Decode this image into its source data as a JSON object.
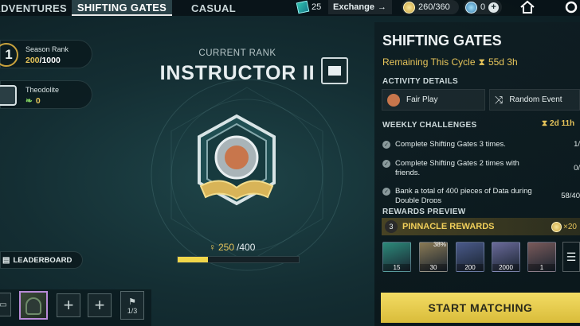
{
  "tabs": [
    {
      "label": "ADVENTURES"
    },
    {
      "label": "SHIFTING GATES"
    },
    {
      "label": "CASUAL"
    }
  ],
  "resources": {
    "cards": "25",
    "exchange": "Exchange",
    "coins": "260/360",
    "gems": "0"
  },
  "left": {
    "season_rank_label": "Season Rank",
    "season_rank_num": "1",
    "season_rank_value": "200",
    "season_rank_max": "/1000",
    "theodolite_label": "Theodolite",
    "theodolite_value": "0",
    "leaderboard": "LEADERBOARD",
    "party_count": "1/3"
  },
  "center": {
    "current_rank_label": "CURRENT RANK",
    "rank_title": "INSTRUCTOR II",
    "progress_current": "250",
    "progress_max": "/400",
    "progress_fraction": 0.25
  },
  "panel": {
    "title": "SHIFTING GATES",
    "remaining_label": "Remaining This Cycle",
    "remaining_time": "55d 3h",
    "activity_details": "ACTIVITY DETAILS",
    "fair_play": "Fair Play",
    "random_event": "Random Event",
    "weekly_challenges": "WEEKLY CHALLENGES",
    "weekly_time": "2d 11h",
    "challenges": [
      {
        "text": "Complete Shifting Gates 3 times.",
        "progress": "1/"
      },
      {
        "text": "Complete Shifting Gates 2 times with friends.",
        "progress": "0/"
      },
      {
        "text": "Bank a total of 400 pieces of Data during Double Drops",
        "progress": "58/40"
      }
    ],
    "rewards_preview": "REWARDS PREVIEW",
    "pinnacle_rank": "3",
    "pinnacle_label": "PINNACLE REWARDS",
    "pinnacle_mult": "×20",
    "rewards": [
      {
        "count": "15",
        "color": "#2c8a7a"
      },
      {
        "count": "30",
        "color": "#8a7a55",
        "badge": "38%"
      },
      {
        "count": "200",
        "color": "#4a5a8a"
      },
      {
        "count": "2000",
        "color": "#6a6a9a"
      },
      {
        "count": "1",
        "color": "#7a5a5a"
      }
    ],
    "start_button": "START MATCHING"
  }
}
